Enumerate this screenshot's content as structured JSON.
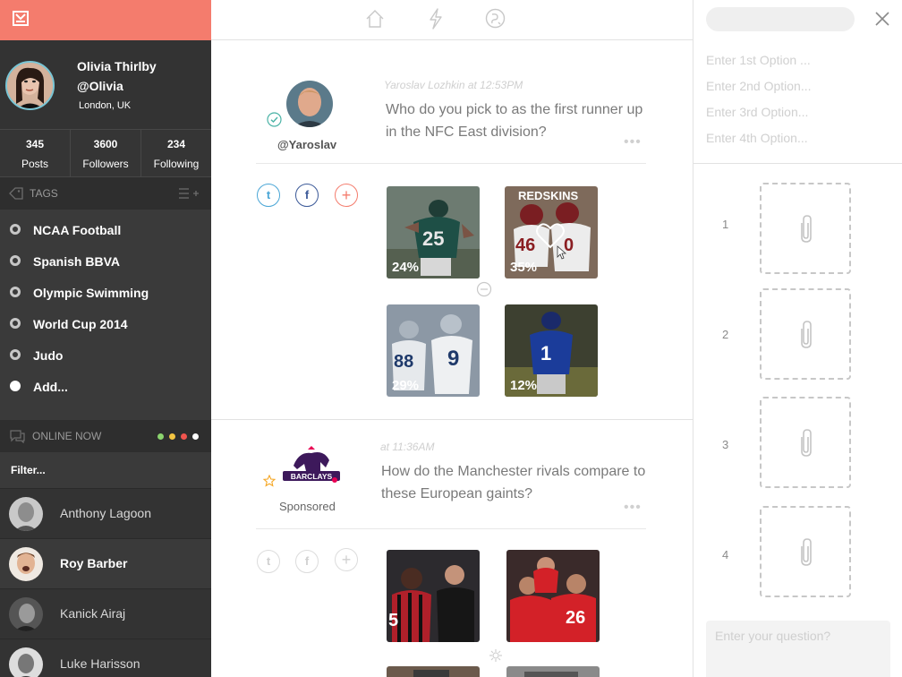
{
  "sidebar": {
    "profile": {
      "name": "Olivia Thirlby",
      "handle": "@Olivia",
      "location": "London, UK"
    },
    "stats": [
      {
        "value": "345",
        "label": "Posts"
      },
      {
        "value": "3600",
        "label": "Followers"
      },
      {
        "value": "234",
        "label": "Following"
      }
    ],
    "tags_header": "TAGS",
    "tags": [
      "NCAA Football",
      "Spanish BBVA",
      "Olympic Swimming",
      "World Cup 2014",
      "Judo",
      "Add..."
    ],
    "online_header": "ONLINE NOW",
    "status_colors": [
      "#8bd46e",
      "#f4c542",
      "#f0544e",
      "#ffffff"
    ],
    "filter_label": "Filter...",
    "users": [
      "Anthony Lagoon",
      "Roy Barber",
      "Kanick Airaj",
      "Luke Harisson"
    ]
  },
  "feed": {
    "post1": {
      "author": "@Yaroslav",
      "meta": "Yaroslav Lozhkin at 12:53PM",
      "question": "Who do you pick to as the first runner up in the NFC East division?",
      "options": [
        {
          "label": "",
          "pct": "24%"
        },
        {
          "label": "REDSKINS",
          "pct": "35%"
        },
        {
          "label": "",
          "pct": "29%"
        },
        {
          "label": "",
          "pct": "12%"
        }
      ],
      "jersey_numbers": [
        "25",
        "46",
        "0",
        "88",
        "9",
        "1"
      ]
    },
    "post2": {
      "brand_text": "BARCLAYS",
      "label": "Sponsored",
      "meta": "at 11:36AM",
      "question": "How do the  Manchester rivals compare to these European gaints?",
      "jersey_numbers": [
        "5",
        "26"
      ]
    },
    "social": {
      "twitter": "t",
      "facebook": "f",
      "add": "+"
    }
  },
  "composer": {
    "options_placeholders": [
      "Enter 1st Option ...",
      "Enter 2nd Option...",
      "Enter 3rd Option...",
      "Enter 4th Option..."
    ],
    "slots": [
      "1",
      "2",
      "3",
      "4"
    ],
    "question_placeholder": "Enter your question?"
  },
  "colors": {
    "accent": "#f47c6d",
    "twitter": "#4aa6d6",
    "facebook": "#3b5998",
    "add": "#f47c6d",
    "sidebar": "#3a3a3a"
  }
}
